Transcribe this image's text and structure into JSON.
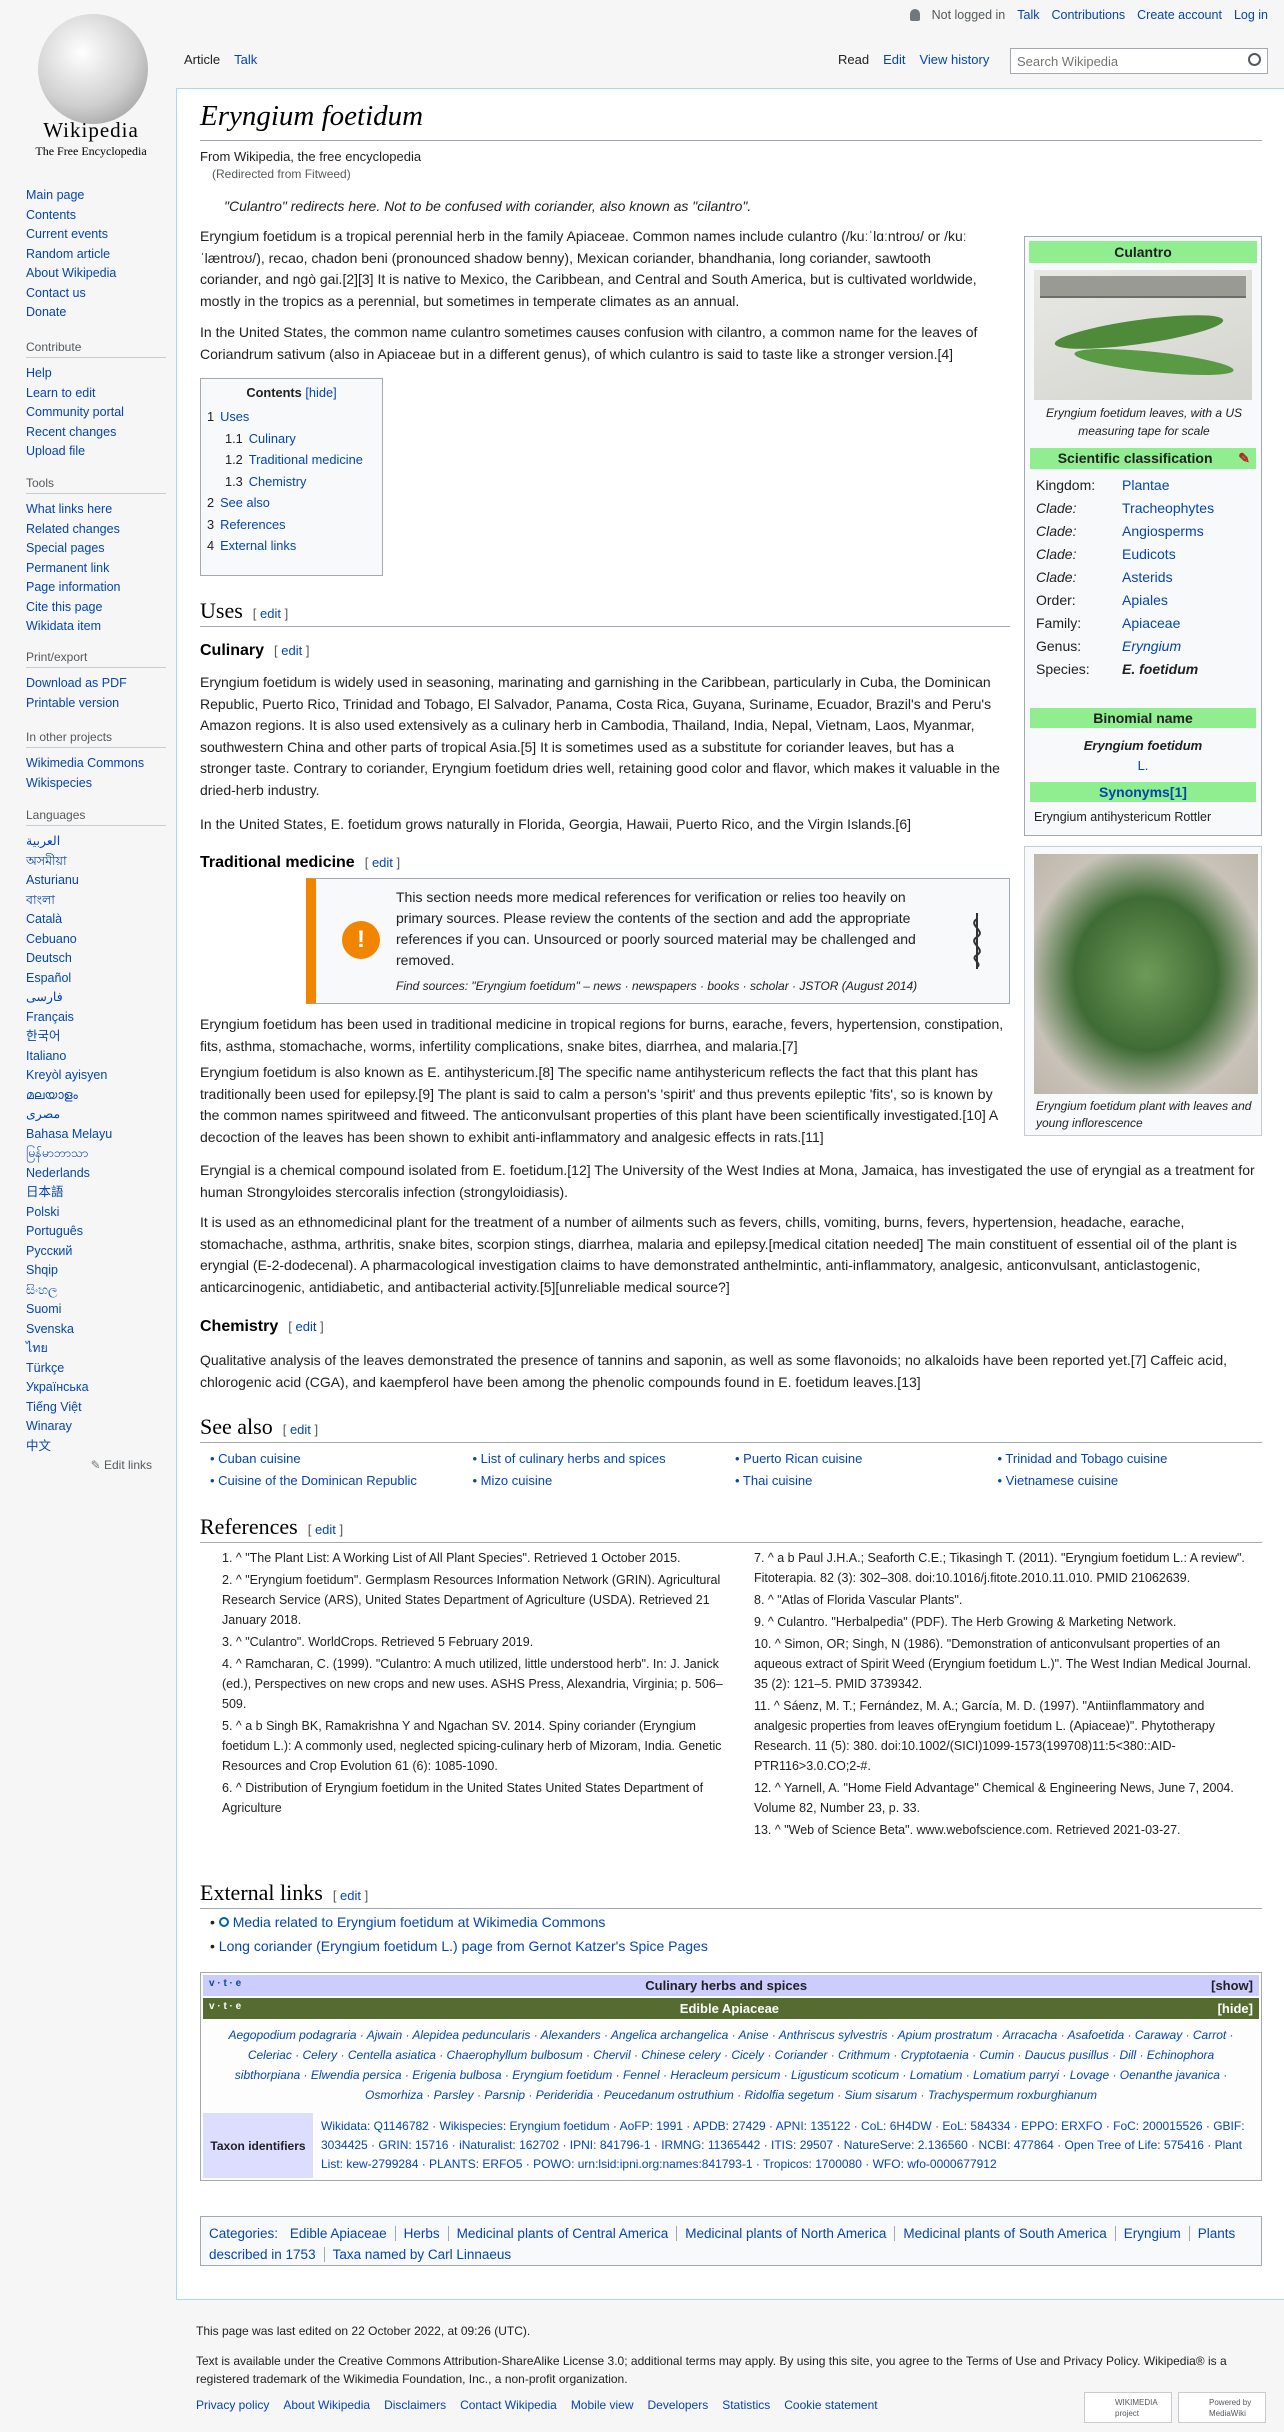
{
  "logo": {
    "wordmark": "Wikipedia",
    "tagline": "The Free Encyclopedia"
  },
  "user_links": [
    "Not logged in",
    "Talk",
    "Contributions",
    "Create account",
    "Log in"
  ],
  "tabs_left": [
    "Article",
    "Talk"
  ],
  "tabs_right": [
    "Read",
    "Edit",
    "View history"
  ],
  "search": {
    "placeholder": "Search Wikipedia"
  },
  "sidebar": {
    "main": [
      "Main page",
      "Contents",
      "Current events",
      "Random article",
      "About Wikipedia",
      "Contact us",
      "Donate"
    ],
    "contribute_title": "Contribute",
    "contribute": [
      "Help",
      "Learn to edit",
      "Community portal",
      "Recent changes",
      "Upload file"
    ],
    "tools_title": "Tools",
    "tools": [
      "What links here",
      "Related changes",
      "Special pages",
      "Permanent link",
      "Page information",
      "Cite this page",
      "Wikidata item"
    ],
    "print_title": "Print/export",
    "print": [
      "Download as PDF",
      "Printable version"
    ],
    "projects_title": "In other projects",
    "projects": [
      "Wikimedia Commons",
      "Wikispecies"
    ],
    "languages_title": "Languages",
    "languages": [
      "العربية",
      "অসমীয়া",
      "Asturianu",
      "বাংলা",
      "Català",
      "Cebuano",
      "Deutsch",
      "Español",
      "فارسی",
      "Français",
      "한국어",
      "Italiano",
      "Kreyòl ayisyen",
      "മലയാളം",
      "مصرى",
      "Bahasa Melayu",
      "မြန်မာဘာသာ",
      "Nederlands",
      "日本語",
      "Polski",
      "Português",
      "Русский",
      "Shqip",
      "සිංහල",
      "Suomi",
      "Svenska",
      "ไทย",
      "Türkçe",
      "Українська",
      "Tiếng Việt",
      "Winaray",
      "中文"
    ],
    "edit_links": "Edit links"
  },
  "article": {
    "title": "Eryngium foetidum",
    "from": "From Wikipedia, the free encyclopedia",
    "redirected": "(Redirected from Fitweed)",
    "hatnote": "\"Culantro\" redirects here. Not to be confused with coriander, also known as \"cilantro\".",
    "intro1": "Eryngium foetidum is a tropical perennial herb in the family Apiaceae. Common names include culantro (/kuːˈlɑːntroʊ/ or /kuːˈlæntroʊ/), recao, chadon beni (pronounced shadow benny), Mexican coriander, bhandhania, long coriander, sawtooth coriander, and ngò gai.[2][3] It is native to Mexico, the Caribbean, and Central and South America, but is cultivated worldwide, mostly in the tropics as a perennial, but sometimes in temperate climates as an annual.",
    "intro2": "In the United States, the common name culantro sometimes causes confusion with cilantro, a common name for the leaves of Coriandrum sativum (also in Apiaceae but in a different genus), of which culantro is said to taste like a stronger version.[4]",
    "toc_title": "Contents",
    "toc_hide": "[hide]",
    "toc": [
      {
        "n": "1",
        "t": "Uses",
        "lvl": 1
      },
      {
        "n": "1.1",
        "t": "Culinary",
        "lvl": 2
      },
      {
        "n": "1.2",
        "t": "Traditional medicine",
        "lvl": 2
      },
      {
        "n": "1.3",
        "t": "Chemistry",
        "lvl": 2
      },
      {
        "n": "2",
        "t": "See also",
        "lvl": 1
      },
      {
        "n": "3",
        "t": "References",
        "lvl": 1
      },
      {
        "n": "4",
        "t": "External links",
        "lvl": 1
      }
    ],
    "edit_label": "edit",
    "h_uses": "Uses",
    "h_culinary": "Culinary",
    "culinary1": "Eryngium foetidum is widely used in seasoning, marinating and garnishing in the Caribbean, particularly in Cuba, the Dominican Republic, Puerto Rico, Trinidad and Tobago, El Salvador, Panama, Costa Rica, Guyana, Suriname, Ecuador, Brazil's and Peru's Amazon regions. It is also used extensively as a culinary herb in Cambodia, Thailand, India, Nepal, Vietnam, Laos, Myanmar, southwestern China and other parts of tropical Asia.[5] It is sometimes used as a substitute for coriander leaves, but has a stronger taste. Contrary to coriander, Eryngium foetidum dries well, retaining good color and flavor, which makes it valuable in the dried-herb industry.",
    "culinary2": "In the United States, E. foetidum grows naturally in Florida, Georgia, Hawaii, Puerto Rico, and the Virgin Islands.[6]",
    "h_trad": "Traditional medicine",
    "ambox_text": "This section needs more medical references for verification or relies too heavily on primary sources. Please review the contents of the section and add the appropriate references if you can. Unsourced or poorly sourced material may be challenged and removed.",
    "ambox_sources": "Find sources: \"Eryngium foetidum\" – news · newspapers · books · scholar · JSTOR (August 2014)",
    "trad1": "Eryngium foetidum has been used in traditional medicine in tropical regions for burns, earache, fevers, hypertension, constipation, fits, asthma, stomachache, worms, infertility complications, snake bites, diarrhea, and malaria.[7]",
    "trad2": "Eryngium foetidum is also known as E. antihystericum.[8] The specific name antihystericum reflects the fact that this plant has traditionally been used for epilepsy.[9] The plant is said to calm a person's 'spirit' and thus prevents epileptic 'fits', so is known by the common names spiritweed and fitweed. The anticonvulsant properties of this plant have been scientifically investigated.[10] A decoction of the leaves has been shown to exhibit anti-inflammatory and analgesic effects in rats.[11]",
    "trad3": "Eryngial is a chemical compound isolated from E. foetidum.[12] The University of the West Indies at Mona, Jamaica, has investigated the use of eryngial as a treatment for human Strongyloides stercoralis infection (strongyloidiasis).",
    "trad4": "It is used as an ethnomedicinal plant for the treatment of a number of ailments such as fevers, chills, vomiting, burns, fevers, hypertension, headache, earache, stomachache, asthma, arthritis, snake bites, scorpion stings, diarrhea, malaria and epilepsy.[medical citation needed] The main constituent of essential oil of the plant is eryngial (E-2-dodecenal). A pharmacological investigation claims to have demonstrated anthelmintic, anti-inflammatory, analgesic, anticonvulsant, anticlastogenic, anticarcinogenic, antidiabetic, and antibacterial activity.[5][unreliable medical source?]",
    "h_chem": "Chemistry",
    "chem1": "Qualitative analysis of the leaves demonstrated the presence of tannins and saponin, as well as some flavonoids; no alkaloids have been reported yet.[7] Caffeic acid, chlorogenic acid (CGA), and kaempferol have been among the phenolic compounds found in E. foetidum leaves.[13]",
    "h_see": "See also",
    "see_also": [
      "Cuban cuisine",
      "Cuisine of the Dominican Republic",
      "List of culinary herbs and spices",
      "Mizo cuisine",
      "Puerto Rican cuisine",
      "Thai cuisine",
      "Trinidad and Tobago cuisine",
      "Vietnamese cuisine"
    ],
    "h_refs": "References",
    "refs_left": [
      "1. ^ \"The Plant List: A Working List of All Plant Species\". Retrieved 1 October 2015.",
      "2. ^ \"Eryngium foetidum\". Germplasm Resources Information Network (GRIN). Agricultural Research Service (ARS), United States Department of Agriculture (USDA). Retrieved 21 January 2018.",
      "3. ^ \"Culantro\". WorldCrops. Retrieved 5 February 2019.",
      "4. ^ Ramcharan, C. (1999). \"Culantro: A much utilized, little understood herb\". In: J. Janick (ed.), Perspectives on new crops and new uses. ASHS Press, Alexandria, Virginia; p. 506–509.",
      "5. ^ a b Singh BK, Ramakrishna Y and Ngachan SV. 2014. Spiny coriander (Eryngium foetidum L.): A commonly used, neglected spicing-culinary herb of Mizoram, India. Genetic Resources and Crop Evolution 61 (6): 1085-1090.",
      "6. ^ Distribution of Eryngium foetidum in the United States United States Department of Agriculture"
    ],
    "refs_right": [
      "7. ^ a b Paul J.H.A.; Seaforth C.E.; Tikasingh T. (2011). \"Eryngium foetidum L.: A review\". Fitoterapia. 82 (3): 302–308. doi:10.1016/j.fitote.2010.11.010. PMID 21062639.",
      "8. ^ \"Atlas of Florida Vascular Plants\".",
      "9. ^ Culantro. \"Herbalpedia\" (PDF). The Herb Growing & Marketing Network.",
      "10. ^ Simon, OR; Singh, N (1986). \"Demonstration of anticonvulsant properties of an aqueous extract of Spirit Weed (Eryngium foetidum L.)\". The West Indian Medical Journal. 35 (2): 121–5. PMID 3739342.",
      "11. ^ Sáenz, M. T.; Fernández, M. A.; García, M. D. (1997). \"Antiinflammatory and analgesic properties from leaves ofEryngium foetidum L. (Apiaceae)\". Phytotherapy Research. 11 (5): 380. doi:10.1002/(SICI)1099-1573(199708)11:5<380::AID-PTR116>3.0.CO;2-#.",
      "12. ^ Yarnell, A. \"Home Field Advantage\" Chemical & Engineering News, June 7, 2004. Volume 82, Number 23, p. 33.",
      "13. ^ \"Web of Science Beta\". www.webofscience.com. Retrieved 2021-03-27."
    ],
    "h_ext": "External links",
    "ext": [
      "Media related to Eryngium foetidum at Wikimedia Commons",
      "Long coriander (Eryngium foetidum L.) page from Gernot Katzer's Spice Pages"
    ]
  },
  "infobox": {
    "title": "Culantro",
    "caption1": "Eryngium foetidum leaves, with a US measuring tape for scale",
    "sci": "Scientific classification",
    "rows": [
      {
        "k": "Kingdom:",
        "v": "Plantae"
      },
      {
        "k": "Clade:",
        "v": "Tracheophytes"
      },
      {
        "k": "Clade:",
        "v": "Angiosperms"
      },
      {
        "k": "Clade:",
        "v": "Eudicots"
      },
      {
        "k": "Clade:",
        "v": "Asterids"
      },
      {
        "k": "Order:",
        "v": "Apiales"
      },
      {
        "k": "Family:",
        "v": "Apiaceae"
      },
      {
        "k": "Genus:",
        "v": "Eryngium"
      },
      {
        "k": "Species:",
        "v": "E. foetidum"
      }
    ],
    "binomial_title": "Binomial name",
    "binomial": "Eryngium foetidum",
    "binomial_author": "L.",
    "synonyms_title": "Synonyms[1]",
    "synonym": "Eryngium antihystericum Rottler",
    "caption2": "Eryngium foetidum plant with leaves and young inflorescence"
  },
  "navbox": {
    "vte": "v · t · e",
    "title": "Culinary herbs and spices",
    "show": "[show]",
    "sub_title": "Edible Apiaceae",
    "hide": "[hide]",
    "items": "Aegopodium podagraria · Ajwain · Alepidea peduncularis · Alexanders · Angelica archangelica · Anise · Anthriscus sylvestris · Apium prostratum · Arracacha · Asafoetida · Caraway · Carrot · Celeriac · Celery · Centella asiatica · Chaerophyllum bulbosum · Chervil · Chinese celery · Cicely · Coriander · Crithmum · Cryptotaenia · Cumin · Daucus pusillus · Dill · Echinophora sibthorpiana · Elwendia persica · Erigenia bulbosa · Eryngium foetidum · Fennel · Heracleum persicum · Ligusticum scoticum · Lomatium · Lomatium parryi · Lovage · Oenanthe javanica · Osmorhiza · Parsley · Parsnip · Perideridia · Peucedanum ostruthium · Ridolfia segetum · Sium sisarum · Trachyspermum roxburghianum",
    "taxon_label": "Taxon identifiers",
    "taxon": "Wikidata: Q1146782 · Wikispecies: Eryngium foetidum · AoFP: 1991 · APDB: 27429 · APNI: 135122 · CoL: 6H4DW · EoL: 584334 · EPPO: ERXFO · FoC: 200015526 · GBIF: 3034425 · GRIN: 15716 · iNaturalist: 162702 · IPNI: 841796-1 · IRMNG: 11365442 · ITIS: 29507 · NatureServe: 2.136560 · NCBI: 477864 · Open Tree of Life: 575416 · Plant List: kew-2799284 · PLANTS: ERFO5 · POWO: urn:lsid:ipni.org:names:841793-1 · Tropicos: 1700080 · WFO: wfo-0000677912"
  },
  "categories": {
    "label": "Categories:",
    "items": [
      "Edible Apiaceae",
      "Herbs",
      "Medicinal plants of Central America",
      "Medicinal plants of North America",
      "Medicinal plants of South America",
      "Eryngium",
      "Plants described in 1753",
      "Taxa named by Carl Linnaeus"
    ]
  },
  "footer": {
    "edited": "This page was last edited on 22 October 2022, at 09:26 (UTC).",
    "license": "Text is available under the Creative Commons Attribution-ShareAlike License 3.0; additional terms may apply. By using this site, you agree to the Terms of Use and Privacy Policy. Wikipedia® is a registered trademark of the Wikimedia Foundation, Inc., a non-profit organization.",
    "links": [
      "Privacy policy",
      "About Wikipedia",
      "Disclaimers",
      "Contact Wikipedia",
      "Mobile view",
      "Developers",
      "Statistics",
      "Cookie statement"
    ],
    "badge1": "WIKIMEDIA project",
    "badge2": "Powered by MediaWiki"
  },
  "colors": {
    "link": "#0645ad",
    "infobox_header": "#90ee90",
    "ambox_accent": "#f28500",
    "navbox_header": "#ccccff",
    "navbox_sub": "#556b2f"
  }
}
